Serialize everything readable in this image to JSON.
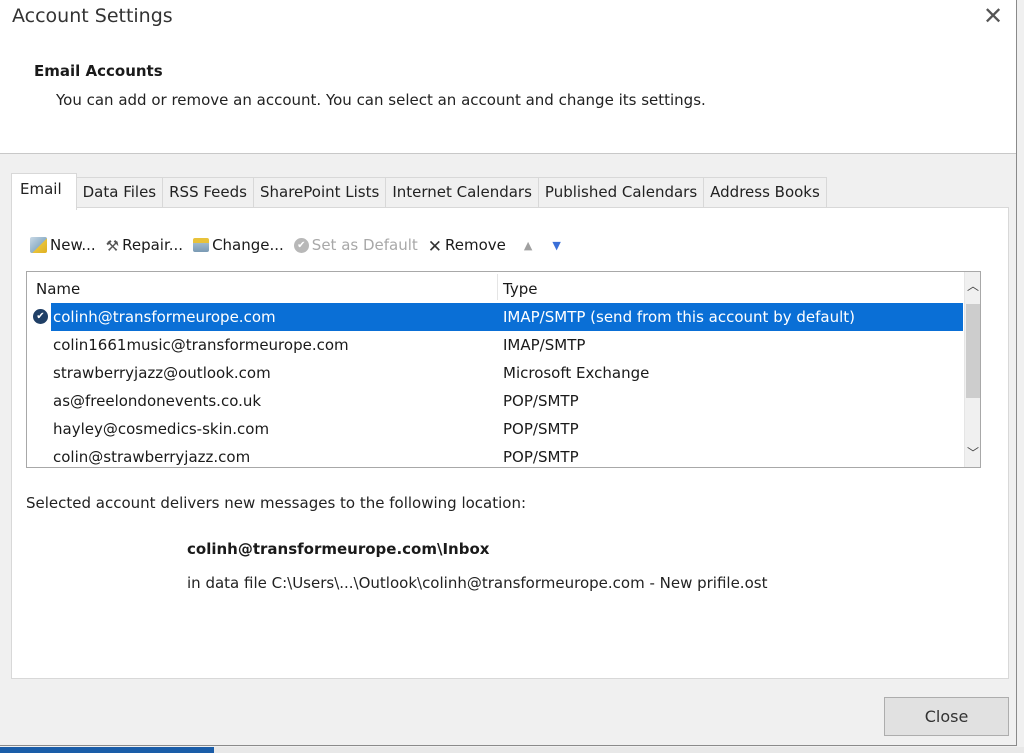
{
  "window": {
    "title": "Account Settings",
    "close_glyph": "✕"
  },
  "header": {
    "section_title": "Email Accounts",
    "description": "You can add or remove an account. You can select an account and change its settings."
  },
  "tabs": [
    {
      "label": "Email",
      "active": true
    },
    {
      "label": "Data Files",
      "active": false
    },
    {
      "label": "RSS Feeds",
      "active": false
    },
    {
      "label": "SharePoint Lists",
      "active": false
    },
    {
      "label": "Internet Calendars",
      "active": false
    },
    {
      "label": "Published Calendars",
      "active": false
    },
    {
      "label": "Address Books",
      "active": false
    }
  ],
  "toolbar": {
    "new_label": "New...",
    "repair_label": "Repair...",
    "change_label": "Change...",
    "set_default_label": "Set as Default",
    "remove_label": "Remove",
    "remove_glyph": "✕",
    "repair_glyph": "⚒",
    "check_glyph": "✔",
    "move_up_glyph": "▲",
    "move_down_glyph": "▼"
  },
  "accounts_list": {
    "columns": {
      "name": "Name",
      "type": "Type"
    },
    "rows": [
      {
        "name": "colinh@transformeurope.com",
        "type": "IMAP/SMTP (send from this account by default)",
        "selected": true,
        "default": true
      },
      {
        "name": "colin1661music@transformeurope.com",
        "type": "IMAP/SMTP",
        "selected": false,
        "default": false
      },
      {
        "name": "strawberryjazz@outlook.com",
        "type": "Microsoft Exchange",
        "selected": false,
        "default": false
      },
      {
        "name": "as@freelondonevents.co.uk",
        "type": "POP/SMTP",
        "selected": false,
        "default": false
      },
      {
        "name": "hayley@cosmedics-skin.com",
        "type": "POP/SMTP",
        "selected": false,
        "default": false
      },
      {
        "name": "colin@strawberryjazz.com",
        "type": "POP/SMTP",
        "selected": false,
        "default": false
      }
    ],
    "scroll_up_glyph": "︿",
    "scroll_down_glyph": "﹀",
    "default_check_glyph": "✔"
  },
  "delivery": {
    "label": "Selected account delivers new messages to the following location:",
    "location": "colinh@transformeurope.com\\Inbox",
    "data_file": "in data file C:\\Users\\...\\Outlook\\colinh@transformeurope.com - New prifile.ost"
  },
  "footer": {
    "close_label": "Close"
  },
  "colors": {
    "selection": "#0a6fd6",
    "default_check": "#1f3f66",
    "move_down_arrow": "#3a6fd8"
  }
}
